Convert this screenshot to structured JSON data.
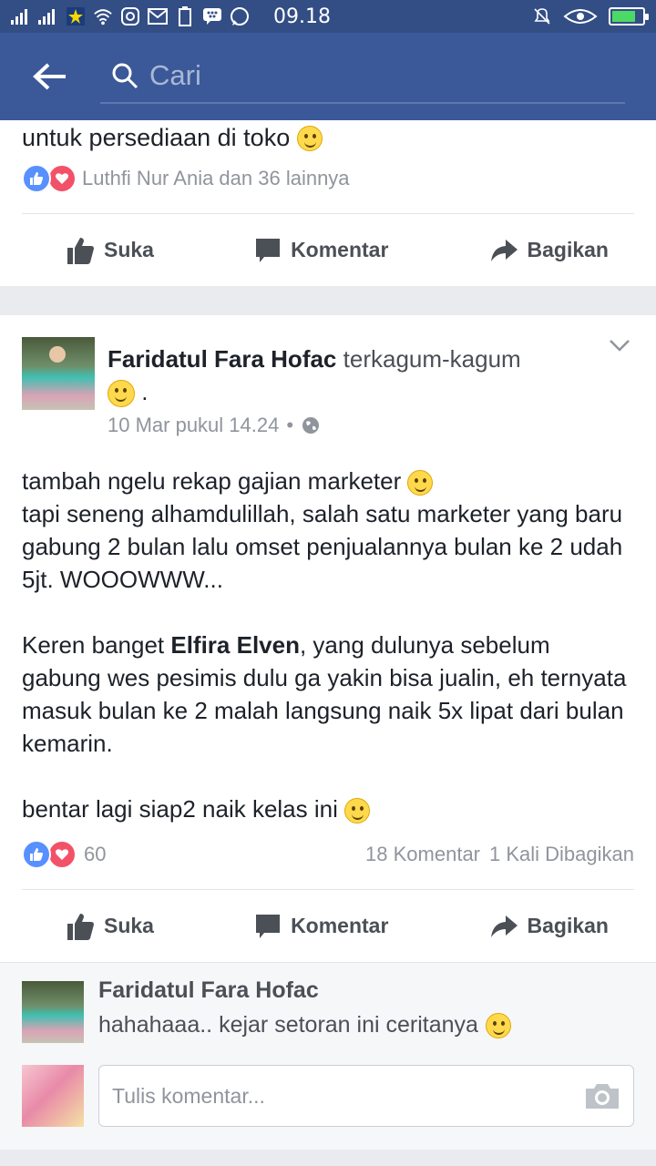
{
  "status_bar": {
    "time": "09.18",
    "icons": [
      "signal-icon",
      "signal-icon",
      "app-icon",
      "wifi-icon",
      "instagram-icon",
      "gmail-icon",
      "battery-saver-icon",
      "bbm-icon",
      "whatsapp-icon",
      "alarm-off-icon",
      "eye-icon",
      "battery-icon"
    ]
  },
  "header": {
    "search_placeholder": "Cari"
  },
  "post1": {
    "text_tail": "untuk persediaan di toko",
    "reactions_text": "Luthfi Nur Ania dan 36 lainnya"
  },
  "actions": {
    "like": "Suka",
    "comment": "Komentar",
    "share": "Bagikan"
  },
  "post2": {
    "author": "Faridatul Fara Hofac",
    "feeling": "terkagum-kagum",
    "feeling_suffix": ".",
    "date": "10 Mar pukul 14.24",
    "dot": "•",
    "body": {
      "line1": "tambah ngelu rekap gajian marketer",
      "line2": "tapi seneng alhamdulillah, salah satu marketer yang baru gabung 2 bulan lalu omset penjualannya bulan ke 2 udah 5jt. WOOOWWW...",
      "p2_prefix": "Keren banget ",
      "p2_mention": "Elfira Elven",
      "p2_rest": ", yang dulunya sebelum gabung wes pesimis dulu ga yakin bisa jualin, eh ternyata masuk bulan ke 2 malah langsung naik 5x lipat dari bulan kemarin.",
      "p3": "bentar lagi siap2 naik kelas ini"
    },
    "reaction_count": "60",
    "comments_count": "18 Komentar",
    "shares_count": "1 Kali Dibagikan"
  },
  "comment": {
    "author": "Faridatul Fara Hofac",
    "text": "hahahaaa.. kejar setoran ini ceritanya"
  },
  "composer": {
    "placeholder": "Tulis komentar..."
  },
  "colors": {
    "header_bg": "#3b5998",
    "status_bg": "#334e85",
    "like_blue": "#5890ff",
    "love_red": "#f25268"
  }
}
